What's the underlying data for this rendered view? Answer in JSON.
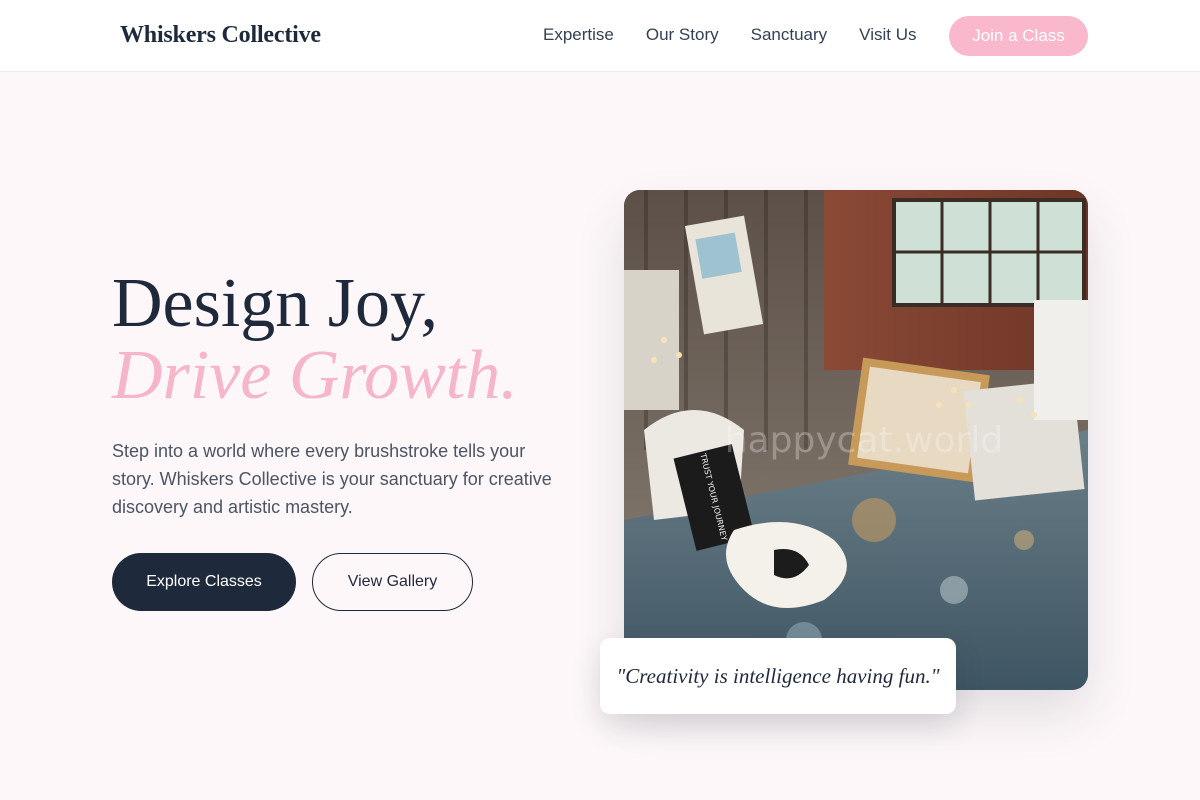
{
  "brand": {
    "name": "Whiskers Collective"
  },
  "nav": {
    "links": [
      "Expertise",
      "Our Story",
      "Sanctuary",
      "Visit Us"
    ],
    "cta_label": "Join a Class"
  },
  "hero": {
    "title_line1": "Design Joy,",
    "title_line2": "Drive Growth.",
    "description": "Step into a world where every brushstroke tells your story. Whiskers Collective is your sanctuary for creative discovery and artistic mastery.",
    "primary_button": "Explore Classes",
    "secondary_button": "View Gallery"
  },
  "photo": {
    "watermark": "happycat.world",
    "sign_text": "TRUST YOUR JOURNEY"
  },
  "quote": {
    "text": "\"Creativity is intelligence having fun.\""
  },
  "colors": {
    "accent": "#f6b5c8",
    "primary": "#1e293b",
    "background": "#fdf7f9"
  }
}
